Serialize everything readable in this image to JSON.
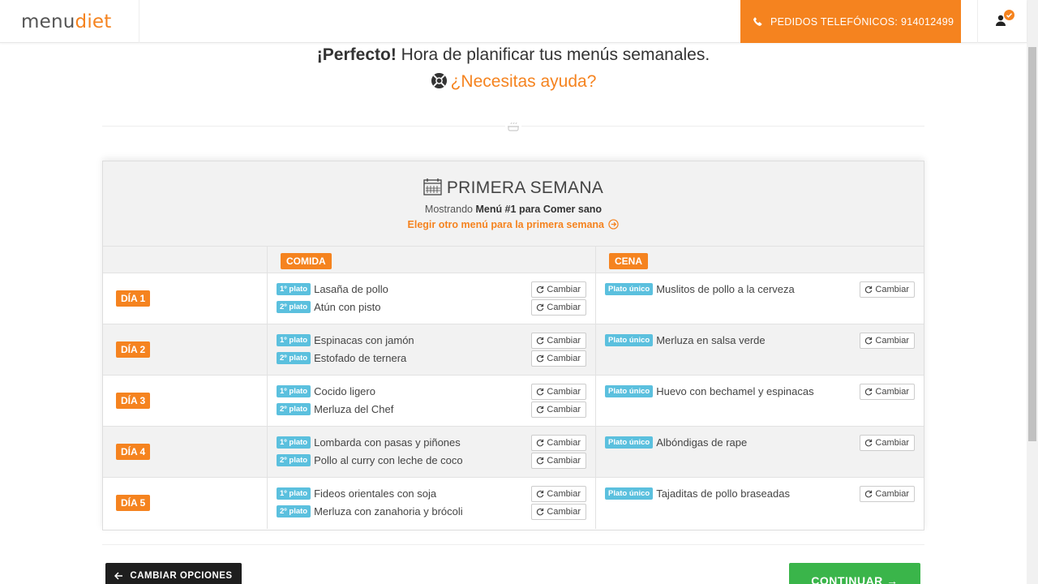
{
  "header": {
    "logo_text_1": "menu",
    "logo_text_2": "diet",
    "phone_label": "PEDIDOS TELEFÓNICOS: 914012499"
  },
  "intro": {
    "heading_bold": "¡Perfecto!",
    "heading_rest": " Hora de planificar tus menús semanales.",
    "help_link": "¿Necesitas ayuda?"
  },
  "week": {
    "title": "PRIMERA SEMANA",
    "showing_prefix": "Mostrando ",
    "showing_menu": "Menú #1 para Comer sano",
    "choose_other": "Elegir otro menú para la primera semana"
  },
  "columns": {
    "lunch": "COMIDA",
    "dinner": "CENA"
  },
  "labels": {
    "first": "1º plato",
    "second": "2º plato",
    "single": "Plato único",
    "change": "Cambiar"
  },
  "days": [
    {
      "label": "DÍA 1",
      "first": "Lasaña de pollo",
      "second": "Atún con pisto",
      "dinner": "Muslitos de pollo a la cerveza"
    },
    {
      "label": "DÍA 2",
      "first": "Espinacas con jamón",
      "second": "Estofado de ternera",
      "dinner": "Merluza en salsa verde"
    },
    {
      "label": "DÍA 3",
      "first": "Cocido ligero",
      "second": "Merluza del Chef",
      "dinner": "Huevo con bechamel y espinacas"
    },
    {
      "label": "DÍA 4",
      "first": "Lombarda con pasas y piñones",
      "second": "Pollo al curry con leche de coco",
      "dinner": "Albóndigas de rape"
    },
    {
      "label": "DÍA 5",
      "first": "Fideos orientales con soja",
      "second": "Merluza con zanahoria y brócoli",
      "dinner": "Tajaditas de pollo braseadas"
    }
  ],
  "actions": {
    "back": "CAMBIAR OPCIONES",
    "next": "CONTINUAR →"
  },
  "colors": {
    "accent": "#f5831f",
    "tag": "#5bc0de",
    "success": "#3ab54a",
    "dark": "#1e1e1e"
  }
}
